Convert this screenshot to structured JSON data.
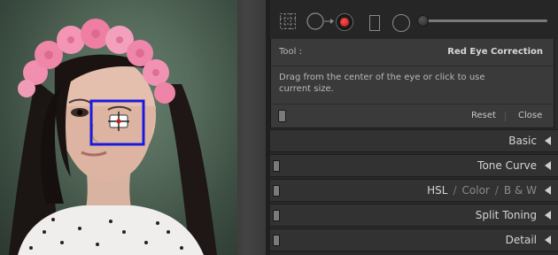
{
  "tool_panel": {
    "tool_label": "Tool :",
    "tool_name": "Red Eye Correction",
    "instructions": "Drag from the center of the eye or click to use current size.",
    "reset_label": "Reset",
    "close_label": "Close"
  },
  "toolstrip": {
    "icons": [
      "crop-overlay-icon",
      "spot-removal-icon",
      "red-eye-correction-icon",
      "graduated-filter-icon",
      "radial-filter-icon",
      "adjustment-brush-slider"
    ]
  },
  "sections": {
    "basic": "Basic",
    "tone_curve": "Tone Curve",
    "hsl": "HSL",
    "color": "Color",
    "bw": "B & W",
    "split_toning": "Split Toning",
    "detail": "Detail"
  },
  "hsl_separator": "/",
  "colors": {
    "selection_box": "#1a1adf",
    "red_eye_dot": "#d01a1a",
    "panel_bg": "#2a2a2a",
    "tool_box_bg": "#3a3a3a"
  }
}
